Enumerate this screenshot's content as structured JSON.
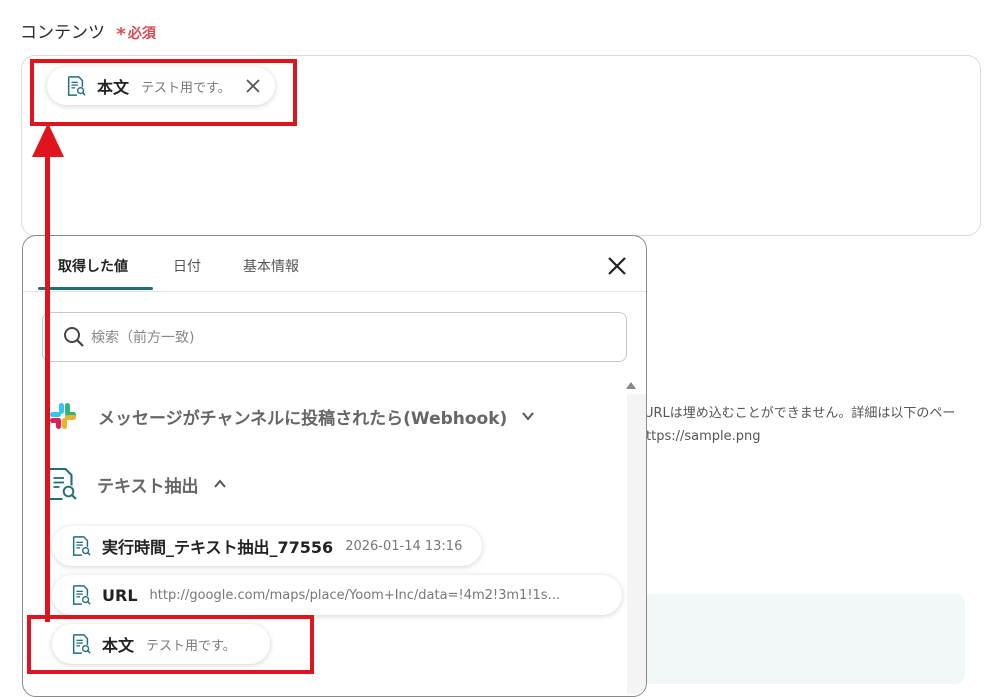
{
  "field": {
    "label": "コンテンツ",
    "required_star": "*",
    "required_text": "必須"
  },
  "selected_chip": {
    "key": "本文",
    "value": "テスト用です。",
    "icon": "document-search-icon",
    "remove_icon": "close-icon"
  },
  "background": {
    "line1": "URLは埋め込むことができません。詳細は以下のペー",
    "line2": "ttps://sample.png"
  },
  "popup": {
    "tabs": [
      {
        "label": "取得した値",
        "active": true
      },
      {
        "label": "日付",
        "active": false
      },
      {
        "label": "基本情報",
        "active": false
      }
    ],
    "search_placeholder": "検索（前方一致)",
    "sections": [
      {
        "title": "メッセージがチャンネルに投稿されたら(Webhook)",
        "icon": "slack-icon",
        "expanded": false
      },
      {
        "title": "テキスト抽出",
        "icon": "document-search-icon",
        "expanded": true
      }
    ],
    "items": [
      {
        "key": "実行時間_テキスト抽出_77556",
        "value": "2026-01-14 13:16"
      },
      {
        "key": "URL",
        "value": "http://google.com/maps/place/Yoom+Inc/data=!4m2!3m1!1s..."
      },
      {
        "key": "本文",
        "value": "テスト用です。"
      }
    ]
  },
  "colors": {
    "accent": "#1f6f7a",
    "highlight": "#e0141c",
    "required": "#e2464f"
  }
}
